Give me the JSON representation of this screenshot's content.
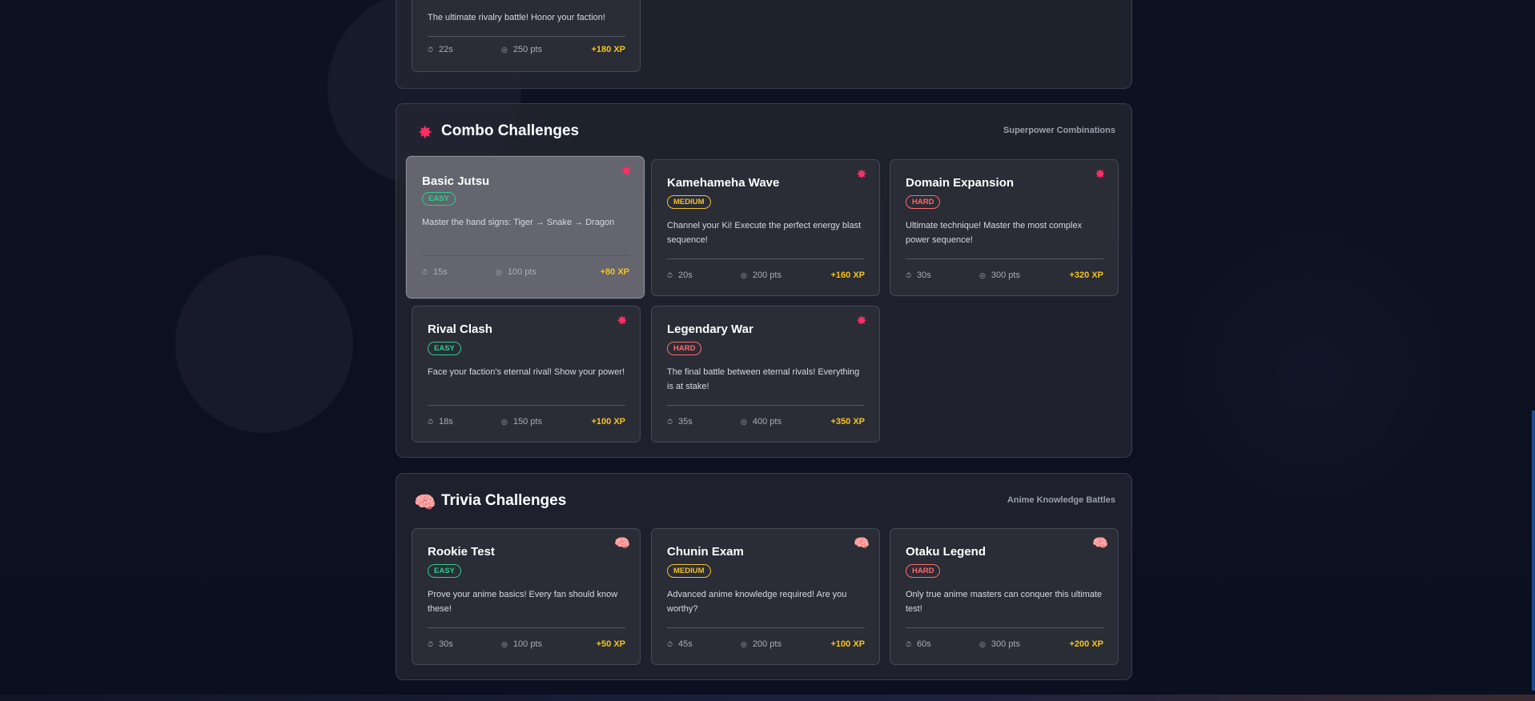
{
  "sections": {
    "top": {
      "card": {
        "description": "The ultimate rivalry battle! Honor your faction!",
        "time": "22s",
        "points": "250 pts",
        "xp": "+180 XP"
      }
    },
    "combo": {
      "icon": "explosion-icon",
      "title": "Combo Challenges",
      "subtitle": "Superpower Combinations",
      "cards": [
        {
          "title": "Basic Jutsu",
          "difficulty": "EASY",
          "description": "Master the hand signs: Tiger → Snake → Dragon",
          "time": "15s",
          "points": "100 pts",
          "xp": "+80 XP"
        },
        {
          "title": "Kamehameha Wave",
          "difficulty": "MEDIUM",
          "description": "Channel your Ki! Execute the perfect energy blast sequence!",
          "time": "20s",
          "points": "200 pts",
          "xp": "+160 XP"
        },
        {
          "title": "Domain Expansion",
          "difficulty": "HARD",
          "description": "Ultimate technique! Master the most complex power sequence!",
          "time": "30s",
          "points": "300 pts",
          "xp": "+320 XP"
        },
        {
          "title": "Rival Clash",
          "difficulty": "EASY",
          "description": "Face your faction's eternal rival! Show your power!",
          "time": "18s",
          "points": "150 pts",
          "xp": "+100 XP"
        },
        {
          "title": "Legendary War",
          "difficulty": "HARD",
          "description": "The final battle between eternal rivals! Everything is at stake!",
          "time": "35s",
          "points": "400 pts",
          "xp": "+350 XP"
        }
      ]
    },
    "trivia": {
      "icon": "brain-icon",
      "title": "Trivia Challenges",
      "subtitle": "Anime Knowledge Battles",
      "cards": [
        {
          "title": "Rookie Test",
          "difficulty": "EASY",
          "description": "Prove your anime basics! Every fan should know these!",
          "time": "30s",
          "points": "100 pts",
          "xp": "+50 XP"
        },
        {
          "title": "Chunin Exam",
          "difficulty": "MEDIUM",
          "description": "Advanced anime knowledge required! Are you worthy?",
          "time": "45s",
          "points": "200 pts",
          "xp": "+100 XP"
        },
        {
          "title": "Otaku Legend",
          "difficulty": "HARD",
          "description": "Only true anime masters can conquer this ultimate test!",
          "time": "60s",
          "points": "300 pts",
          "xp": "+200 XP"
        }
      ]
    }
  },
  "icons": {
    "timer": "stopwatch-icon",
    "points": "target-icon"
  },
  "colors": {
    "easy": "#2ecc8a",
    "medium": "#f1c232",
    "hard": "#ff6b6b",
    "xp": "#f5c518"
  }
}
